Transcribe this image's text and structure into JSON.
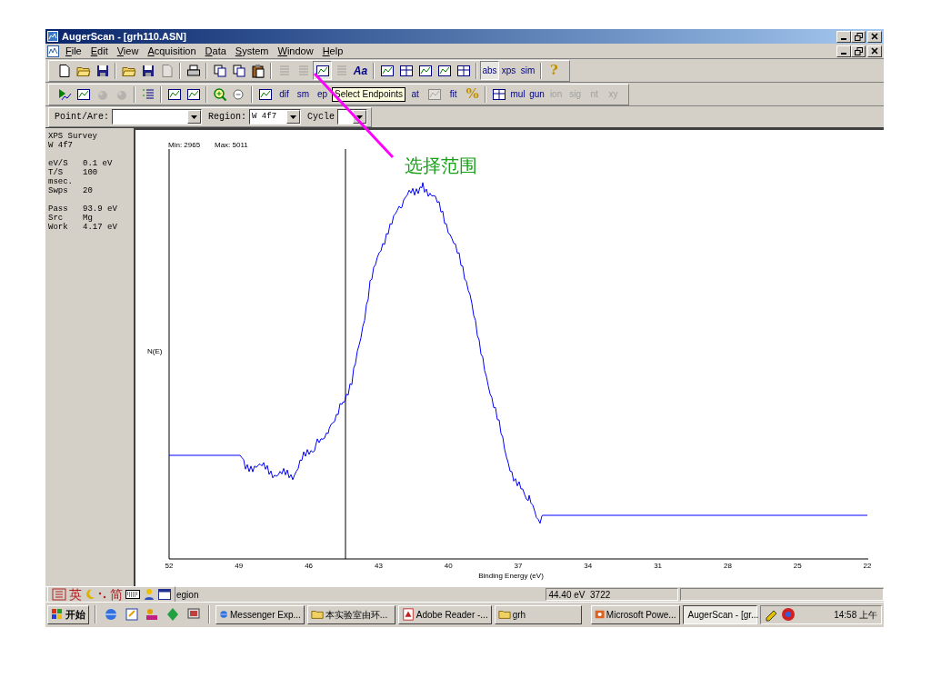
{
  "window": {
    "title": "AugerScan - [grh110.ASN]"
  },
  "menu": [
    "File",
    "Edit",
    "View",
    "Acquisition",
    "Data",
    "System",
    "Window",
    "Help"
  ],
  "toolbar_1": [
    {
      "kind": "tool",
      "disabled": false,
      "pressed": false
    },
    {
      "kind": "tool",
      "disabled": false,
      "pressed": false
    },
    {
      "kind": "tool",
      "disabled": false,
      "pressed": false
    },
    {
      "kind": "sep"
    },
    {
      "kind": "tool",
      "disabled": false,
      "pressed": false
    },
    {
      "kind": "tool",
      "disabled": false,
      "pressed": false
    },
    {
      "kind": "tool",
      "disabled": true,
      "pressed": false
    },
    {
      "kind": "sep"
    },
    {
      "kind": "tool",
      "disabled": false,
      "pressed": false
    },
    {
      "kind": "sep"
    },
    {
      "kind": "tool",
      "disabled": false,
      "pressed": false
    },
    {
      "kind": "tool",
      "disabled": false,
      "pressed": false
    },
    {
      "kind": "tool",
      "disabled": false,
      "pressed": false
    },
    {
      "kind": "sep"
    },
    {
      "kind": "tool",
      "disabled": true,
      "pressed": false
    },
    {
      "kind": "tool",
      "disabled": true,
      "pressed": false
    },
    {
      "kind": "tool",
      "disabled": false,
      "pressed": true
    },
    {
      "kind": "tool",
      "disabled": true,
      "pressed": false
    },
    {
      "kind": "tool",
      "label": "Aa",
      "disabled": false,
      "pressed": false
    },
    {
      "kind": "sep"
    },
    {
      "kind": "tool",
      "disabled": false,
      "pressed": false
    },
    {
      "kind": "tool",
      "disabled": false,
      "pressed": false
    },
    {
      "kind": "tool",
      "disabled": false,
      "pressed": false
    },
    {
      "kind": "tool",
      "disabled": false,
      "pressed": false
    },
    {
      "kind": "tool",
      "disabled": false,
      "pressed": false
    },
    {
      "kind": "sep"
    },
    {
      "kind": "tool",
      "label": "abs",
      "disabled": false,
      "pressed": true
    },
    {
      "kind": "tool",
      "label": "xps",
      "disabled": false,
      "pressed": false
    },
    {
      "kind": "tool",
      "label": "sim",
      "disabled": false,
      "pressed": false
    },
    {
      "kind": "sep"
    },
    {
      "kind": "tool",
      "label": "?",
      "disabled": false,
      "pressed": false
    }
  ],
  "toolbar_2": [
    {
      "kind": "tool",
      "disabled": false,
      "pressed": false
    },
    {
      "kind": "tool",
      "disabled": false,
      "pressed": false
    },
    {
      "kind": "tool",
      "disabled": true,
      "pressed": false
    },
    {
      "kind": "tool",
      "disabled": true,
      "pressed": false
    },
    {
      "kind": "sep"
    },
    {
      "kind": "tool",
      "disabled": false,
      "pressed": false
    },
    {
      "kind": "sep"
    },
    {
      "kind": "tool",
      "disabled": false,
      "pressed": false
    },
    {
      "kind": "tool",
      "disabled": false,
      "pressed": false
    },
    {
      "kind": "sep"
    },
    {
      "kind": "tool",
      "disabled": false,
      "pressed": false
    },
    {
      "kind": "tool",
      "disabled": false,
      "pressed": false
    },
    {
      "kind": "sep"
    },
    {
      "kind": "tool",
      "disabled": false,
      "pressed": false
    },
    {
      "kind": "tool",
      "label": "dif",
      "disabled": false,
      "pressed": false
    },
    {
      "kind": "tool",
      "label": "sm",
      "disabled": false,
      "pressed": false
    },
    {
      "kind": "tool",
      "label": "ep",
      "disabled": false,
      "pressed": false
    },
    {
      "kind": "tooltip",
      "text": "Select Endpoints"
    },
    {
      "kind": "tool",
      "label": "at",
      "disabled": false,
      "pressed": false
    },
    {
      "kind": "tool",
      "disabled": true,
      "pressed": false
    },
    {
      "kind": "tool",
      "label": "fit",
      "disabled": false,
      "pressed": false
    },
    {
      "kind": "tool",
      "label": "%",
      "disabled": false,
      "pressed": false
    },
    {
      "kind": "sep"
    },
    {
      "kind": "tool",
      "disabled": false,
      "pressed": false
    },
    {
      "kind": "tool",
      "label": "mul",
      "disabled": false,
      "pressed": false
    },
    {
      "kind": "tool",
      "label": "gun",
      "disabled": false,
      "pressed": false
    },
    {
      "kind": "tool",
      "label": "ion",
      "disabled": true,
      "pressed": false
    },
    {
      "kind": "tool",
      "label": "sig",
      "disabled": true,
      "pressed": false
    },
    {
      "kind": "tool",
      "label": "nt",
      "disabled": true,
      "pressed": false
    },
    {
      "kind": "tool",
      "label": "xy",
      "disabled": true,
      "pressed": false
    }
  ],
  "selectors": [
    {
      "label": "Point/Are:"
    },
    {
      "label": "Region:",
      "value": "W 4f7"
    },
    {
      "label": "Cycle"
    }
  ],
  "info_panel": {
    "title": "XPS Survey",
    "region": "W 4f7",
    "groups": [
      [
        {
          "name": "eV/S",
          "value": "0.1 eV"
        },
        {
          "name": "T/S",
          "value": "100"
        },
        {
          "name": "msec."
        },
        {
          "name": "Swps",
          "value": "20"
        }
      ],
      [
        {
          "name": "Pass",
          "value": "93.9 eV"
        },
        {
          "name": "Src",
          "value": "Mg"
        },
        {
          "name": "Work",
          "value": "4.17 eV"
        }
      ]
    ]
  },
  "plot": {
    "min": "Min: 2965",
    "max": "Max: 5011",
    "ylabel": "N(E)",
    "xlabel": "Binding Energy (eV)",
    "xticks": [
      "52",
      "49",
      "46",
      "43",
      "40",
      "37",
      "34",
      "31",
      "28",
      "25",
      "22"
    ]
  },
  "annotation": {
    "text": "选择范围"
  },
  "ime_bar": [
    "英",
    "简"
  ],
  "status_bar": {
    "text": "egion",
    "reading": "44.40 eV  3722"
  },
  "taskbar": {
    "start": "开始",
    "tasks": [
      {
        "label": "Messenger Exp...",
        "selected": false
      },
      {
        "label": "本实验室由环...",
        "selected": false
      },
      {
        "label": "Adobe Reader -...",
        "selected": false
      },
      {
        "label": "grh",
        "selected": false
      },
      {
        "label": "Microsoft Powe...",
        "selected": false
      },
      {
        "label": "AugerScan - [gr...",
        "selected": true
      }
    ],
    "clock": "14:58 上午"
  }
}
